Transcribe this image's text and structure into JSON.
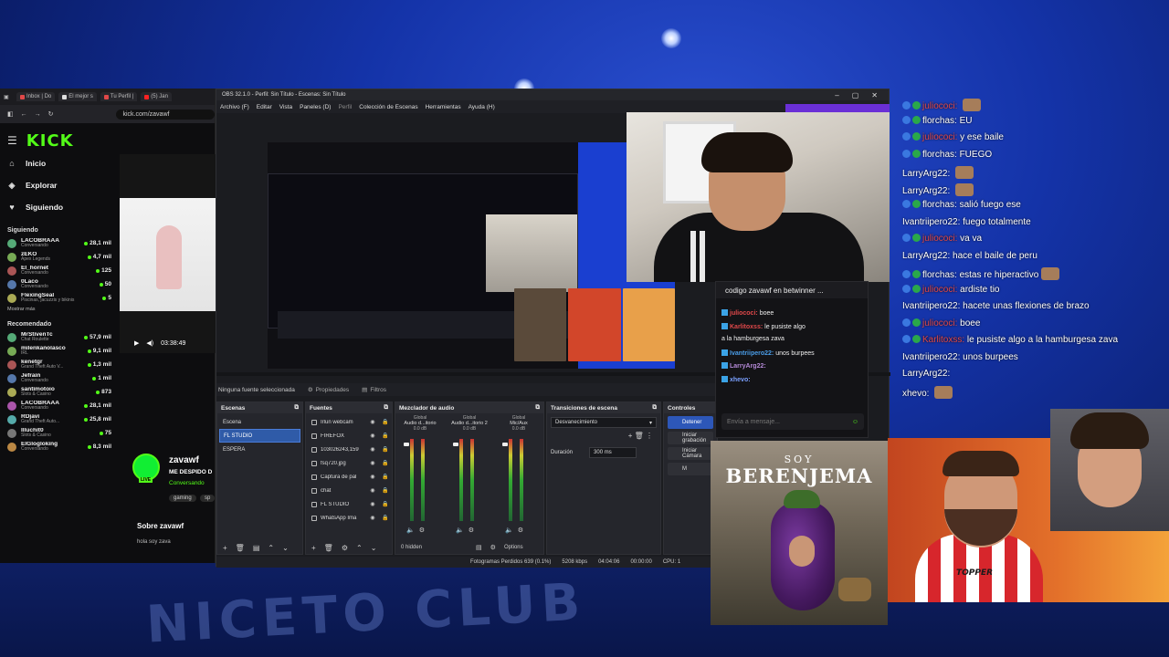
{
  "browser": {
    "tabs": [
      {
        "label": "Inbox | Do"
      },
      {
        "label": "El mejor s"
      },
      {
        "label": "Tu Perfil |"
      },
      {
        "label": "(5) Jan"
      }
    ],
    "url": "kick.com/zavawf"
  },
  "kick": {
    "logo": "KICK",
    "nav": [
      {
        "label": "Inicio",
        "icon": "home-icon"
      },
      {
        "label": "Explorar",
        "icon": "compass-icon"
      },
      {
        "label": "Siguiendo",
        "icon": "heart-icon"
      }
    ],
    "following_title": "Siguiendo",
    "following": [
      {
        "name": "LACOBRAAA",
        "category": "Conversando",
        "count": "28,1 mil"
      },
      {
        "name": "zEKO",
        "category": "Apex Legends",
        "count": "4,7 mil"
      },
      {
        "name": "El_hornet",
        "category": "Conversando",
        "count": "125"
      },
      {
        "name": "0Laco",
        "category": "Conversando",
        "count": "50"
      },
      {
        "name": "FlexingSeal",
        "category": "Piscinas, jacuzzis y bikinis",
        "count": "5"
      }
    ],
    "show_more": "Mostrar más",
    "recommended_title": "Recomendado",
    "recommended": [
      {
        "name": "MrStivenTc",
        "category": "Chat Roulette",
        "count": "57,9 mil"
      },
      {
        "name": "milenkanolasco",
        "category": "IRL",
        "count": "9,1 mil"
      },
      {
        "name": "kenetgr",
        "category": "Grand Theft Auto V...",
        "count": "1,3 mil"
      },
      {
        "name": "Jefrain",
        "category": "Conversando",
        "count": "1 mil"
      },
      {
        "name": "santimotoio",
        "category": "Slots & Casino",
        "count": "873"
      },
      {
        "name": "LACOBRAAA",
        "category": "Conversando",
        "count": "28,1 mil"
      },
      {
        "name": "RDjavi",
        "category": "Grand Theft Auto...",
        "count": "25,8 mil"
      },
      {
        "name": "Illuchit0",
        "category": "Slots & Casino",
        "count": "75"
      },
      {
        "name": "ElGlogloking",
        "category": "Conversando",
        "count": "8,3 mil"
      }
    ],
    "player_time": "03:38:49",
    "streamer": {
      "name": "zavawf",
      "title": "ME DESPIDO D",
      "status": "Conversando",
      "tags": [
        "gaming",
        "sp"
      ],
      "live_badge": "LIVE"
    },
    "about_title": "Sobre zavawf",
    "about_text": "hola soy zava"
  },
  "obs": {
    "title": "OBS 32.1.0 - Perfil: Sin Título - Escenas: Sin Título",
    "menu": [
      "Archivo (F)",
      "Editar",
      "Vista",
      "Paneles (D)",
      "Perfil",
      "Colección de Escenas",
      "Herramientas",
      "Ayuda (H)"
    ],
    "no_source": "Ninguna fuente seleccionada",
    "properties": "Propiedades",
    "filters": "Filtros",
    "scenes_title": "Escenas",
    "scenes": [
      {
        "name": "Escena",
        "selected": false
      },
      {
        "name": "FL STUDIO",
        "selected": true
      },
      {
        "name": "ESPERA",
        "selected": false
      }
    ],
    "sources_title": "Fuentes",
    "sources": [
      {
        "name": "Irlun webcam"
      },
      {
        "name": "FIREFOX"
      },
      {
        "name": "103026243,159"
      },
      {
        "name": "fsq720.jpg"
      },
      {
        "name": "Captura de pal"
      },
      {
        "name": "chat"
      },
      {
        "name": "FL STUDIO"
      },
      {
        "name": "WhatsApp Ima"
      }
    ],
    "mixer_title": "Mezclador de audio",
    "mixer": [
      {
        "name": "Audio d...itorio",
        "label": "Global",
        "db": "0.0 dB"
      },
      {
        "name": "Audio d...itorio 2",
        "label": "Global",
        "db": "0.0 dB"
      },
      {
        "name": "Mic/Aux",
        "label": "Global",
        "db": "0.0 dB"
      }
    ],
    "mixer_hidden": "0 hidden",
    "mixer_options": "Options",
    "transitions_title": "Transiciones de escena",
    "transition": "Desvanecimiento",
    "duration_label": "Duración",
    "duration": "300 ms",
    "controls_title": "Controles",
    "controls": [
      "Detener",
      "Iniciar grabación",
      "Iniciar Cámara",
      "M"
    ],
    "status_frames": "Fotogramas Perdidos 639 (0.1%)",
    "status_kbps": "5208 kbps",
    "status_live": "04:04:06",
    "status_rec": "00:00:00",
    "status_cpu": "CPU: 1"
  },
  "obs_chat": {
    "pinned": "codigo zavawf en betwinner ...",
    "lines": [
      {
        "user": "juliococi:",
        "msg": "boee",
        "color": "#e0484a"
      },
      {
        "user": "Karlitoxss:",
        "msg": "le pusiste algo",
        "color": "#e0484a"
      },
      {
        "user": "",
        "msg": "a la hamburgesa zava",
        "color": "#eeeeee"
      },
      {
        "user": "Ivantriipero22:",
        "msg": "unos burpees",
        "color": "#4a9de8"
      },
      {
        "user": "LarryArg22:",
        "msg": "",
        "color": "#b58ad8"
      },
      {
        "user": "xhevo:",
        "msg": "",
        "color": "#7aa0ff"
      }
    ],
    "input_placeholder": "Envía a mensaje..."
  },
  "overlay_chat": [
    {
      "user": "juliococi:",
      "msg": "",
      "style": "red",
      "badges": true,
      "emote": true
    },
    {
      "user": "florchas:",
      "msg": "EU",
      "style": "plain",
      "badges": true,
      "emote": false
    },
    {
      "user": "juliococi:",
      "msg": "y ese baile",
      "style": "red",
      "badges": true,
      "emote": false
    },
    {
      "user": "florchas:",
      "msg": "FUEGO",
      "style": "plain",
      "badges": true,
      "emote": false
    },
    {
      "user": "LarryArg22:",
      "msg": "",
      "style": "plain",
      "badges": false,
      "emote": true
    },
    {
      "user": "LarryArg22:",
      "msg": "",
      "style": "plain",
      "badges": false,
      "emote": true
    },
    {
      "user": "florchas:",
      "msg": "salió fuego ese",
      "style": "plain",
      "badges": true,
      "emote": false
    },
    {
      "user": "Ivantriipero22:",
      "msg": "fuego totalmente",
      "style": "plain",
      "badges": false,
      "emote": false
    },
    {
      "user": "juliococi:",
      "msg": "va va",
      "style": "red",
      "badges": true,
      "emote": false
    },
    {
      "user": "LarryArg22:",
      "msg": "hace el baile de peru",
      "style": "plain",
      "badges": false,
      "emote": false
    },
    {
      "user": "florchas:",
      "msg": "estas re hiperactivo",
      "style": "plain",
      "badges": true,
      "emote": true
    },
    {
      "user": "juliococi:",
      "msg": "ardiste tio",
      "style": "red",
      "badges": true,
      "emote": false
    },
    {
      "user": "Ivantriipero22:",
      "msg": "hacete unas flexiones de brazo",
      "style": "plain",
      "badges": false,
      "emote": false
    },
    {
      "user": "juliococi:",
      "msg": "boee",
      "style": "red",
      "badges": true,
      "emote": false
    },
    {
      "user": "Karlitoxss:",
      "msg": "le pusiste algo a la hamburgesa zava",
      "style": "red",
      "badges": true,
      "emote": false
    },
    {
      "user": "Ivantriipero22:",
      "msg": "unos burpees",
      "style": "plain",
      "badges": false,
      "emote": false
    },
    {
      "user": "LarryArg22:",
      "msg": "",
      "style": "plain",
      "badges": false,
      "emote": false
    },
    {
      "user": "xhevo:",
      "msg": "",
      "style": "plain",
      "badges": false,
      "emote": true
    }
  ],
  "poster": {
    "soy": "SOY",
    "title": "BERENJEMA"
  },
  "face_card": {
    "shirt_text": "TOPPER"
  },
  "stage": {
    "floor_text": "NICETO CLUB"
  }
}
